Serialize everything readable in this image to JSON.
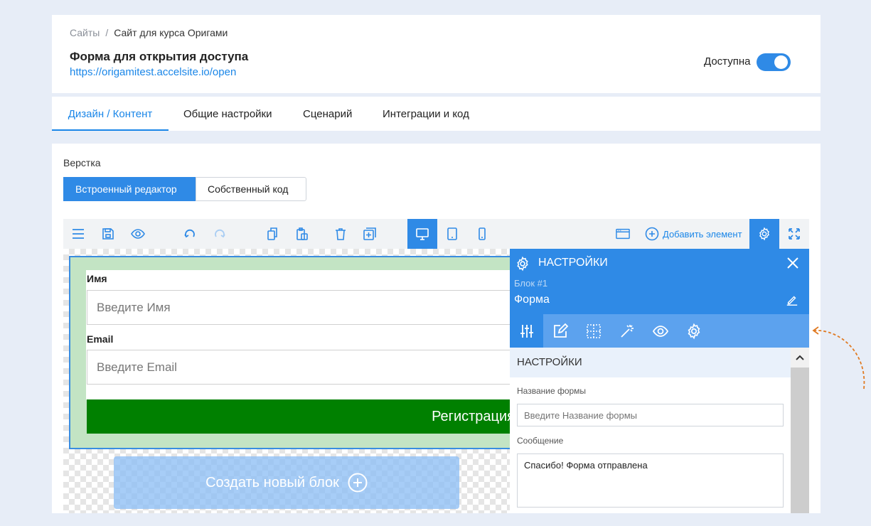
{
  "header": {
    "breadcrumb": {
      "root": "Сайты",
      "separator": "/",
      "current": "Сайт для курса Оригами"
    },
    "title": "Форма для открытия доступа",
    "url": "https://origamitest.accelsite.io/open",
    "available_label": "Доступна",
    "available_on": true
  },
  "tabs": [
    {
      "label": "Дизайн / Контент",
      "active": true
    },
    {
      "label": "Общие настройки",
      "active": false
    },
    {
      "label": "Сценарий",
      "active": false
    },
    {
      "label": "Интеграции и код",
      "active": false
    }
  ],
  "layout": {
    "label": "Верстка",
    "builtin_editor": "Встроенный редактор",
    "custom_code": "Собственный код"
  },
  "toolbar": {
    "add_element": "Добавить элемент",
    "icons": [
      "menu-icon",
      "save-icon",
      "preview-eye-icon",
      "undo-icon",
      "redo-icon",
      "copy-icon",
      "paste-icon",
      "delete-icon",
      "duplicate-add-icon",
      "desktop-icon",
      "tablet-icon",
      "mobile-icon",
      "browser-window-icon",
      "add-circle-icon",
      "settings-gear-icon",
      "fullscreen-icon"
    ],
    "active_device": "desktop"
  },
  "form": {
    "name_label": "Имя",
    "name_placeholder": "Введите Имя",
    "email_label": "Email",
    "email_placeholder": "Введите Email",
    "submit": "Регистрация",
    "block_color": "#c3e4c4",
    "button_color": "#008000"
  },
  "new_block": "Создать новый блок",
  "panel": {
    "title": "НАСТРОЙКИ",
    "block_number": "Блок #1",
    "block_name": "Форма",
    "section_title": "НАСТРОЙКИ",
    "form_name_label": "Название формы",
    "form_name_placeholder": "Введите Название формы",
    "message_label": "Сообщение",
    "message_value": "Спасибо! Форма отправлена",
    "tab_icons": [
      "sliders-icon",
      "edit-icon",
      "grid-icon",
      "magic-wand-icon",
      "eye-icon",
      "gear-icon"
    ]
  },
  "colors": {
    "accent": "#2f8ae6",
    "link": "#1a86e8",
    "background": "#e7edf7",
    "annotation_arrow": "#e07b24"
  }
}
